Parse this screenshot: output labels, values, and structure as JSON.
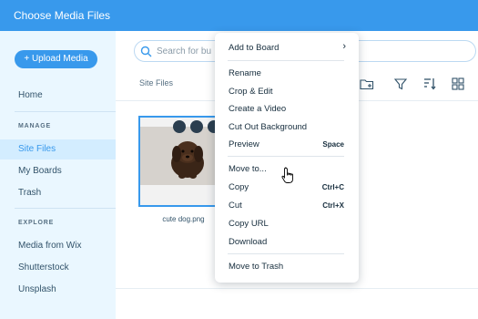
{
  "header": {
    "title": "Choose Media Files"
  },
  "sidebar": {
    "upload_label": "+ Upload Media",
    "home": "Home",
    "manage_label": "MANAGE",
    "manage_items": [
      "Site Files",
      "My Boards",
      "Trash"
    ],
    "explore_label": "EXPLORE",
    "explore_items": [
      "Media from Wix",
      "Shutterstock",
      "Unsplash"
    ]
  },
  "main": {
    "search_placeholder": "Search for bu",
    "breadcrumb": "Site Files",
    "file_name": "cute dog.png"
  },
  "context_menu": {
    "add_to_board": "Add to Board",
    "rename": "Rename",
    "crop_edit": "Crop & Edit",
    "create_video": "Create a Video",
    "cut_background": "Cut Out Background",
    "preview": "Preview",
    "preview_shortcut": "Space",
    "move_to": "Move to...",
    "copy": "Copy",
    "copy_shortcut": "Ctrl+C",
    "cut": "Cut",
    "cut_shortcut": "Ctrl+X",
    "copy_url": "Copy URL",
    "download": "Download",
    "move_to_trash": "Move to Trash"
  },
  "colors": {
    "accent": "#3899ec",
    "sidebar_bg": "#eaf7ff",
    "active_bg": "#d3edff",
    "text": "#162d3d"
  }
}
